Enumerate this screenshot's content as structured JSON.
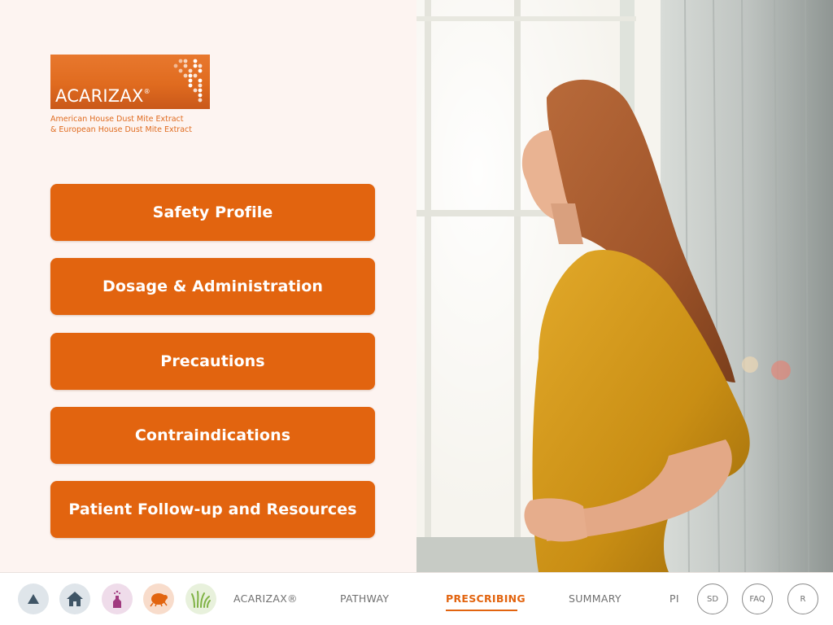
{
  "logo": {
    "name": "ACARIZAX",
    "registered": "®",
    "tagline_line1": "American House Dust Mite Extract",
    "tagline_line2": "& European House Dust Mite Extract"
  },
  "menu": {
    "items": [
      {
        "label": "Safety Profile"
      },
      {
        "label": "Dosage & Administration"
      },
      {
        "label": "Precautions"
      },
      {
        "label": "Contraindications"
      },
      {
        "label": "Patient Follow-up and Resources"
      }
    ]
  },
  "bottom_nav": {
    "icons": [
      {
        "name": "up-triangle-icon"
      },
      {
        "name": "home-icon"
      },
      {
        "name": "bottle-icon"
      },
      {
        "name": "dust-mite-icon"
      },
      {
        "name": "grass-icon"
      }
    ],
    "tabs": [
      {
        "label": "ACARIZAX®",
        "active": false
      },
      {
        "label": "PATHWAY",
        "active": false
      },
      {
        "label": "PRESCRIBING",
        "active": true
      },
      {
        "label": "SUMMARY",
        "active": false
      },
      {
        "label": "PI",
        "active": false
      }
    ],
    "rings": [
      {
        "label": "SD"
      },
      {
        "label": "FAQ"
      },
      {
        "label": "R"
      }
    ]
  },
  "colors": {
    "brand_orange": "#e2640f",
    "background": "#fdf4f1",
    "nav_text": "#707070"
  }
}
